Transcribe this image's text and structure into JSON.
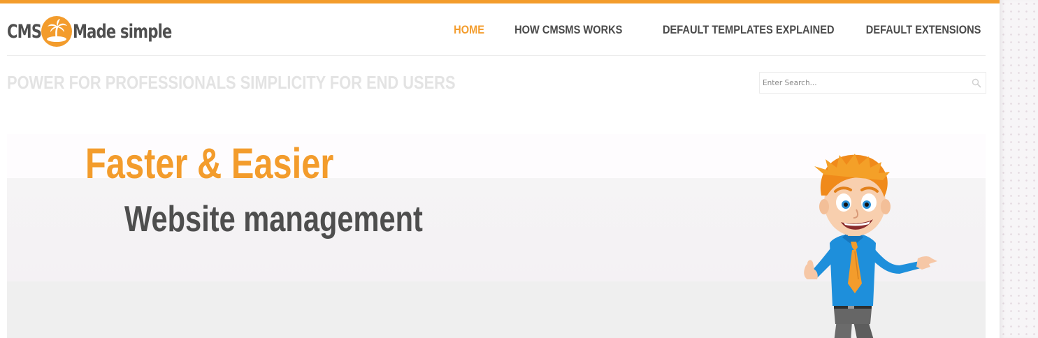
{
  "header": {
    "logo": {
      "part1": "CMS",
      "part2": "Made simple"
    },
    "nav": [
      {
        "label": "HOME",
        "active": true
      },
      {
        "label": "HOW CMSMS WORKS",
        "active": false
      },
      {
        "label": "DEFAULT TEMPLATES EXPLAINED",
        "active": false
      },
      {
        "label": "DEFAULT EXTENSIONS",
        "active": false
      }
    ]
  },
  "tagline": "POWER FOR PROFESSIONALS SIMPLICITY FOR END USERS",
  "search": {
    "placeholder": "Enter Search...",
    "value": ""
  },
  "hero": {
    "title": "Faster & Easier",
    "subtitle": "Website management"
  },
  "colors": {
    "accent": "#f39c2c",
    "text_dark": "#4e4e4e",
    "tagline": "#e3e3e3"
  },
  "icons": {
    "logo_badge": "palm-island-icon",
    "search": "search-icon",
    "hero_art": "mascot-illustration"
  }
}
